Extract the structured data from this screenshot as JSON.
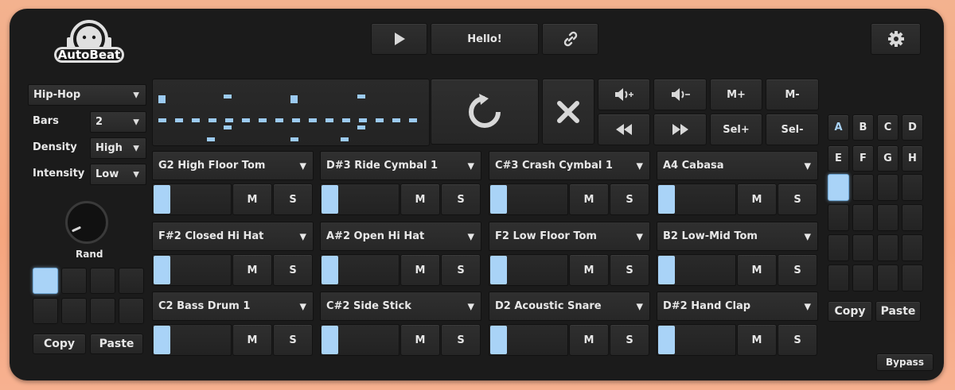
{
  "logo": {
    "text": "AutoBeat"
  },
  "transport": {
    "play_icon": "play-icon",
    "message": "Hello!",
    "link_icon": "link-icon",
    "settings_icon": "gear-icon"
  },
  "left": {
    "style_value": "Hip-Hop",
    "bars_label": "Bars",
    "bars_value": "2",
    "density_label": "Density",
    "density_value": "High",
    "intensity_label": "Intensity",
    "intensity_value": "Low",
    "rand_label": "Rand",
    "copy_label": "Copy",
    "paste_label": "Paste"
  },
  "controls": {
    "vol_up": "🔊+",
    "vol_down": "🔊-",
    "m_plus": "M+",
    "m_minus": "M-",
    "sel_plus": "Sel+",
    "sel_minus": "Sel-"
  },
  "tracks": [
    {
      "name": "G2 High Floor Tom",
      "mute": "M",
      "solo": "S"
    },
    {
      "name": "D#3 Ride Cymbal 1",
      "mute": "M",
      "solo": "S"
    },
    {
      "name": "C#3 Crash Cymbal 1",
      "mute": "M",
      "solo": "S"
    },
    {
      "name": "A4 Cabasa",
      "mute": "M",
      "solo": "S"
    },
    {
      "name": "F#2 Closed Hi Hat",
      "mute": "M",
      "solo": "S"
    },
    {
      "name": "A#2 Open Hi Hat",
      "mute": "M",
      "solo": "S"
    },
    {
      "name": "F2 Low Floor Tom",
      "mute": "M",
      "solo": "S"
    },
    {
      "name": "B2 Low-Mid Tom",
      "mute": "M",
      "solo": "S"
    },
    {
      "name": "C2 Bass Drum 1",
      "mute": "M",
      "solo": "S"
    },
    {
      "name": "C#2 Side Stick",
      "mute": "M",
      "solo": "S"
    },
    {
      "name": "D2 Acoustic Snare",
      "mute": "M",
      "solo": "S"
    },
    {
      "name": "D#2 Hand Clap",
      "mute": "M",
      "solo": "S"
    }
  ],
  "right": {
    "banks": [
      "A",
      "B",
      "C",
      "D",
      "E",
      "F",
      "G",
      "H"
    ],
    "copy_label": "Copy",
    "paste_label": "Paste",
    "bypass_label": "Bypass"
  },
  "colors": {
    "accent": "#a9d3f7",
    "panel": "#1b1b1b"
  }
}
